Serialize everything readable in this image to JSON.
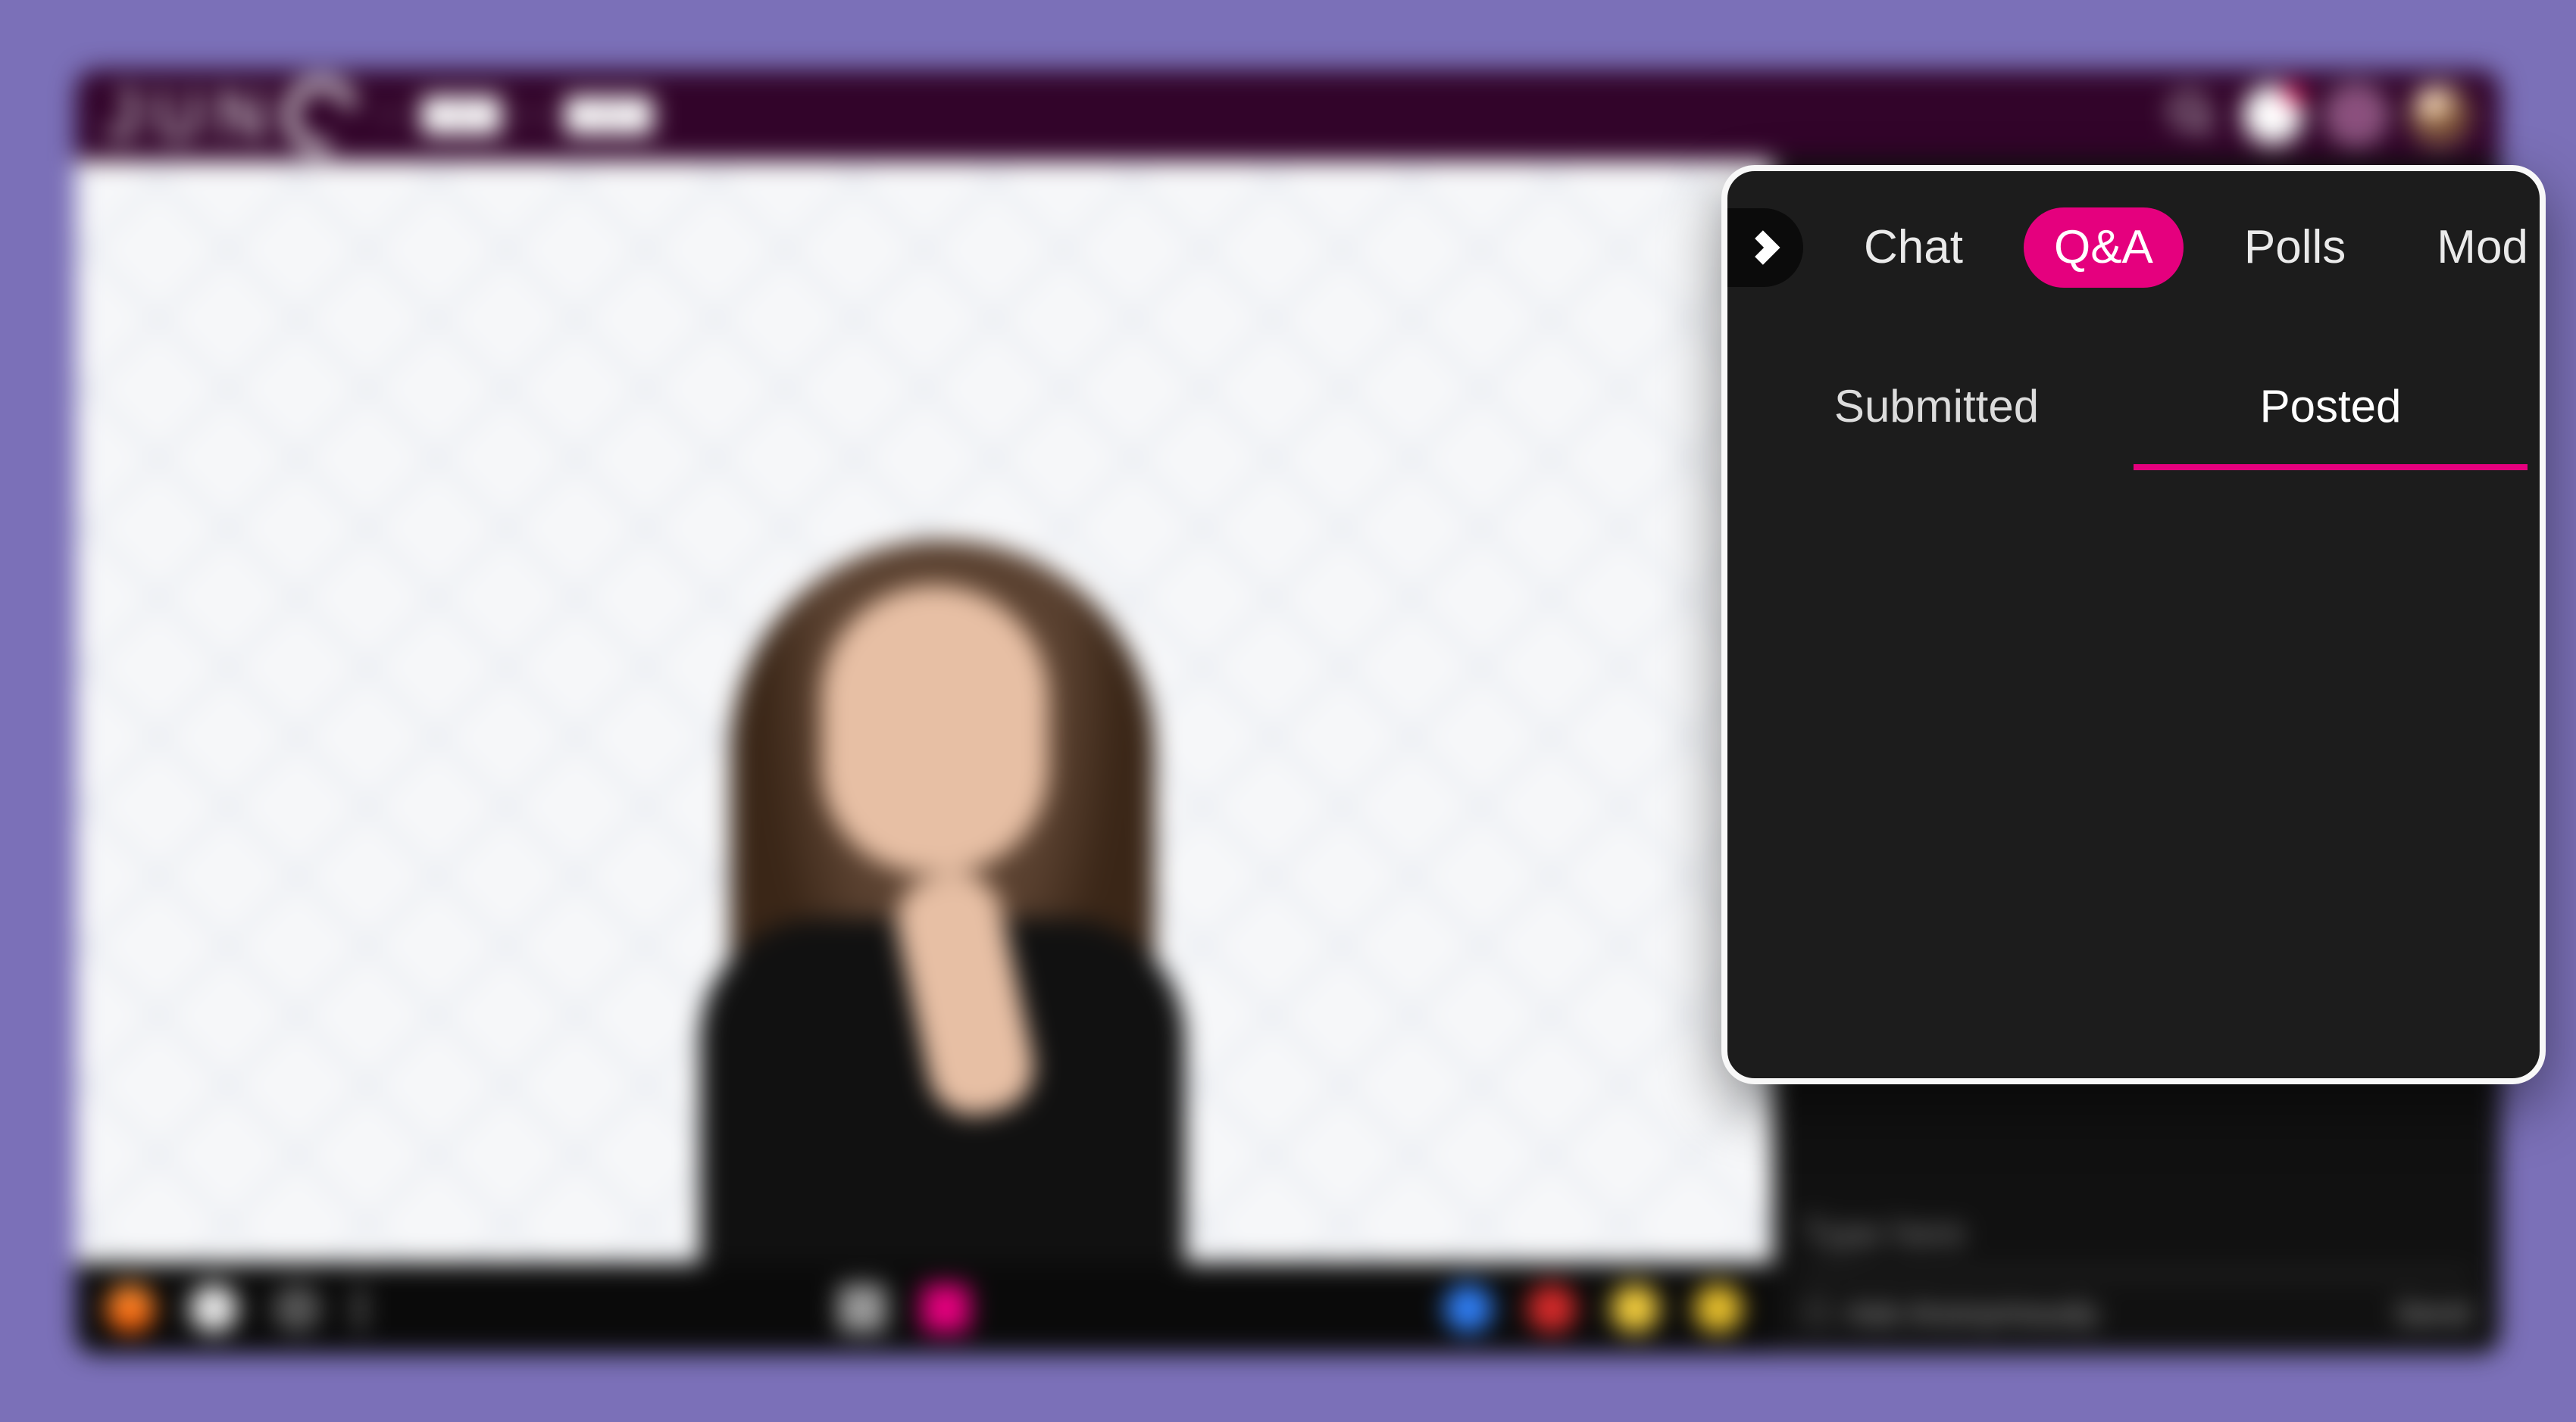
{
  "brand": {
    "logo_text": "JUN"
  },
  "panel": {
    "tabs": {
      "chat": "Chat",
      "qa": "Q&A",
      "polls": "Polls",
      "mod": "Mod",
      "active": "qa"
    },
    "subtabs": {
      "submitted": "Submitted",
      "posted": "Posted",
      "active": "posted"
    }
  },
  "compose": {
    "placeholder": "Type here",
    "anon_label": "Ask Anonymously",
    "send_label": "Send"
  },
  "colors": {
    "accent": "#e5007e",
    "panel_bg": "#1c1c1c",
    "page_bg": "#7b70b8"
  }
}
